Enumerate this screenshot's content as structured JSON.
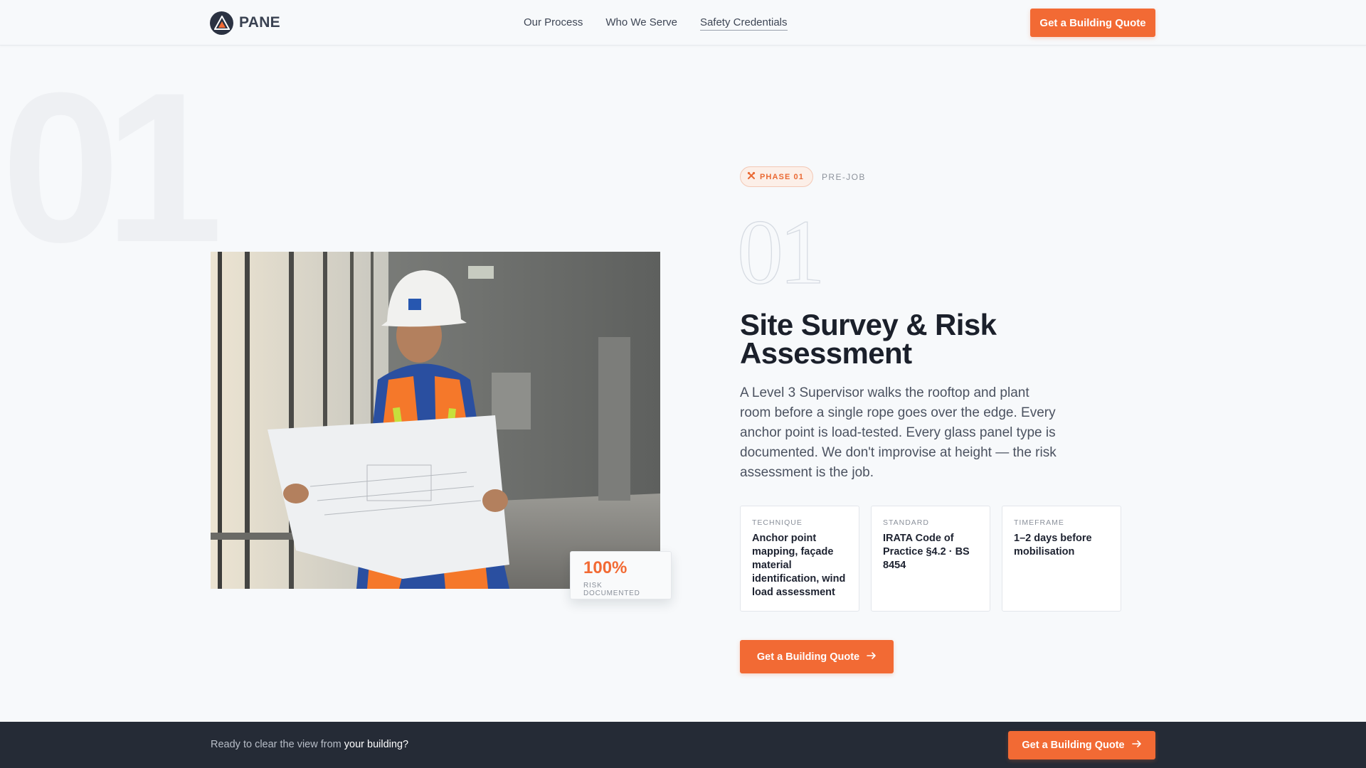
{
  "nav": {
    "brand": "PANE",
    "links": [
      {
        "label": "Our Process"
      },
      {
        "label": "Who We Serve"
      },
      {
        "label": "Safety Credentials"
      }
    ],
    "cta_label": "Get a Building Quote"
  },
  "hero": {
    "bg_number": "01",
    "phase_badge": "PHASE 01",
    "phase_sub": "PRE-JOB",
    "outline_number": "01",
    "title": "Site Survey & Risk Assessment",
    "body": "A Level 3 Supervisor walks the rooftop and plant room before a single rope goes over the edge. Every anchor point is load-tested. Every glass panel type is documented. We don't improvise at height — the risk assessment is the job.",
    "stat": {
      "value": "100%",
      "label": "RISK DOCUMENTED"
    },
    "cards": [
      {
        "label": "TECHNIQUE",
        "value": "Anchor point mapping, façade material identification, wind load assessment"
      },
      {
        "label": "STANDARD",
        "value": "IRATA Code of Practice §4.2 · BS 8454"
      },
      {
        "label": "TIMEFRAME",
        "value": "1–2 days before mobilisation"
      }
    ],
    "cta_label": "Get a Building Quote"
  },
  "bottom_bar": {
    "text_prefix": "Ready to clear the view from ",
    "text_highlight": "your building?",
    "cta_label": "Get a Building Quote"
  },
  "colors": {
    "accent": "#f26a34",
    "dark": "#252b36",
    "background": "#f7f9fb"
  },
  "icons": {
    "brand": "triangle-logo-icon",
    "phase": "tools-icon",
    "cta": "arrow-right-icon"
  }
}
